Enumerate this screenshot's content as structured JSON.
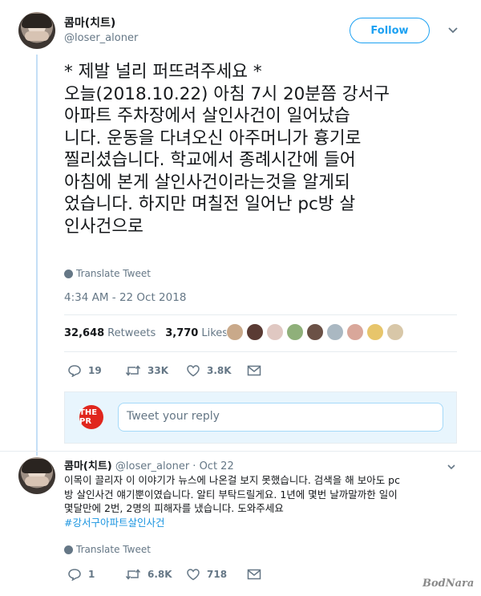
{
  "tweet": {
    "name": "콤마(치트)",
    "handle": "@loser_aloner",
    "follow_label": "Follow",
    "text_lines": [
      "* 제발 널리 퍼뜨려주세요 *",
      "오늘(2018.10.22) 아침 7시 20분쯤 강서구",
      "아파트 주차장에서 살인사건이 일어났습",
      "니다. 운동을 다녀오신 아주머니가 흉기로",
      "찔리셨습니다. 학교에서 종례시간에 들어",
      "아침에 본게 살인사건이라는것을 알게되",
      "었습니다. 하지만 며칠전 일어난 pc방 살",
      "인사건으로"
    ],
    "translate_label": "Translate Tweet",
    "timestamp": "4:34 AM - 22 Oct 2018",
    "retweets_count": "32,648",
    "retweets_label": "Retweets",
    "likes_count": "3,770",
    "likes_label": "Likes",
    "actions": {
      "replies": "19",
      "retweets": "33K",
      "likes": "3.8K"
    }
  },
  "reply_box": {
    "avatar_text": "THE PR",
    "placeholder": "Tweet your reply"
  },
  "reply": {
    "name": "콤마(치트)",
    "meta": "@loser_aloner · Oct 22",
    "text_lines": [
      "이목이 끌리자 이 이야기가 뉴스에 나온걸 보지 못했습니다. 검색을 해 보아도 pc",
      "방 살인사건 얘기뿐이였습니다. 알티 부탁드릴게요. 1년에 몇번 날까말까한 일이",
      "몇달만에 2번, 2명의 피해자를 냈습니다. 도와주세요"
    ],
    "hashtag": "#강서구아파트살인사건",
    "translate_label": "Translate Tweet",
    "actions": {
      "replies": "1",
      "retweets": "6.8K",
      "likes": "718"
    }
  },
  "watermark": "BodNara",
  "colors": {
    "accent": "#1da1f2",
    "muted": "#657786",
    "thread": "#c4dff6",
    "brand_red": "#e0261d"
  }
}
